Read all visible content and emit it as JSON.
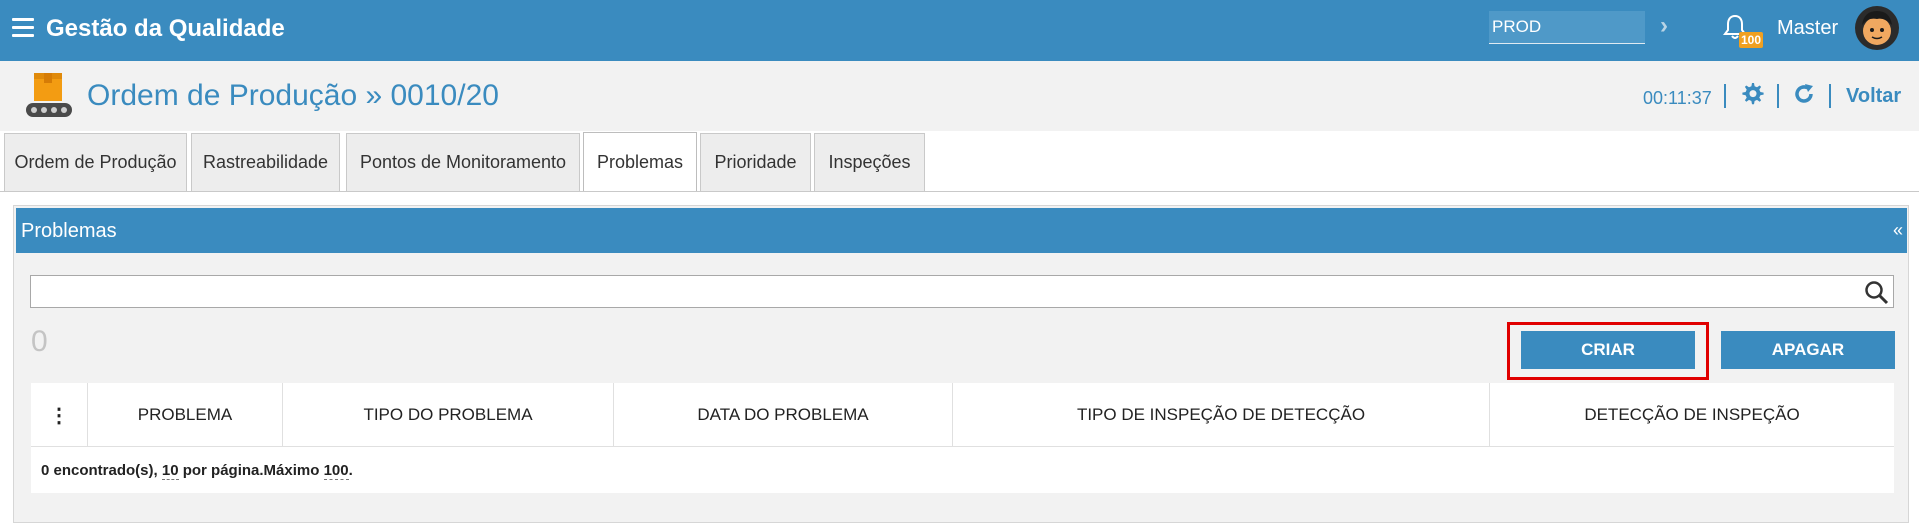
{
  "topbar": {
    "app_title": "Gestão da Qualidade",
    "environment_value": "PROD",
    "notification_count": "100",
    "user_name": "Master",
    "bg_color": "#3a8bbf"
  },
  "header": {
    "title": "Ordem de Produção » 0010/20",
    "timer": "00:11:37",
    "back_label": "Voltar",
    "accent_color": "#3a8bbf"
  },
  "tabs": [
    {
      "label": "Ordem de Produção",
      "active": false
    },
    {
      "label": "Rastreabilidade",
      "active": false
    },
    {
      "label": "Pontos de Monitoramento",
      "active": false
    },
    {
      "label": "Problemas",
      "active": true
    },
    {
      "label": "Prioridade",
      "active": false
    },
    {
      "label": "Inspeções",
      "active": false
    }
  ],
  "panel": {
    "title": "Problemas",
    "collapse_symbol": "«",
    "search_value": "",
    "count": "0",
    "create_label": "CRIAR",
    "delete_label": "APAGAR",
    "highlight_color": "#e00000"
  },
  "grid": {
    "menu_symbol": "⋮",
    "columns": [
      "PROBLEMA",
      "TIPO DO PROBLEMA",
      "DATA DO PROBLEMA",
      "TIPO DE INSPEÇÃO DE DETECÇÃO",
      "DETECÇÃO DE INSPEÇÃO"
    ],
    "footer": {
      "found_text": "0 encontrado(s), ",
      "per_page": "10",
      "per_page_text": " por página.Máximo ",
      "max": "100",
      "end": "."
    }
  }
}
